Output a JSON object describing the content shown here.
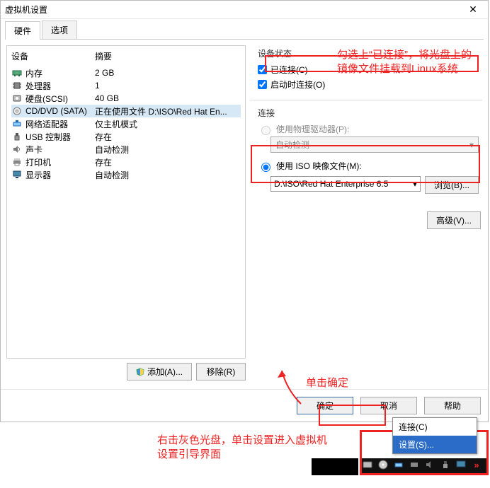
{
  "window": {
    "title": "虚拟机设置",
    "close_x": "✕"
  },
  "tabs": [
    {
      "label": "硬件",
      "active": true
    },
    {
      "label": "选项",
      "active": false
    }
  ],
  "device_list": {
    "col_device": "设备",
    "col_summary": "摘要",
    "rows": [
      {
        "icon": "memory-icon",
        "name": "内存",
        "summary": "2 GB",
        "selected": false
      },
      {
        "icon": "cpu-icon",
        "name": "处理器",
        "summary": "1",
        "selected": false
      },
      {
        "icon": "disk-icon",
        "name": "硬盘(SCSI)",
        "summary": "40 GB",
        "selected": false
      },
      {
        "icon": "cd-icon",
        "name": "CD/DVD (SATA)",
        "summary": "正在使用文件 D:\\ISO\\Red Hat En...",
        "selected": true
      },
      {
        "icon": "net-icon",
        "name": "网络适配器",
        "summary": "仅主机模式",
        "selected": false
      },
      {
        "icon": "usb-icon",
        "name": "USB 控制器",
        "summary": "存在",
        "selected": false
      },
      {
        "icon": "sound-icon",
        "name": "声卡",
        "summary": "自动检测",
        "selected": false
      },
      {
        "icon": "printer-icon",
        "name": "打印机",
        "summary": "存在",
        "selected": false
      },
      {
        "icon": "display-icon",
        "name": "显示器",
        "summary": "自动检测",
        "selected": false
      }
    ]
  },
  "buttons": {
    "add": "添加(A)...",
    "remove": "移除(R)"
  },
  "status_group": {
    "label": "设备状态",
    "connected": "已连接(C)",
    "connect_on_start": "启动时连接(O)"
  },
  "conn_group": {
    "label": "连接",
    "use_physical": "使用物理驱动器(P):",
    "auto_detect": "自动检测",
    "use_iso": "使用 ISO 映像文件(M):",
    "iso_path": "D:\\ISO\\Red Hat Enterprise 6.5",
    "browse": "浏览(B)...",
    "advanced": "高级(V)..."
  },
  "bottom": {
    "ok": "确定",
    "cancel": "取消",
    "help": "帮助"
  },
  "annotations": {
    "a1": "勾选上“已连接”，将光盘上的镜像文件挂载到Linux系统",
    "a2": "单击确定",
    "a3": "右击灰色光盘，单击设置进入虚拟机设置引导界面"
  },
  "context_menu": {
    "connect": "连接(C)",
    "settings": "设置(S)..."
  }
}
